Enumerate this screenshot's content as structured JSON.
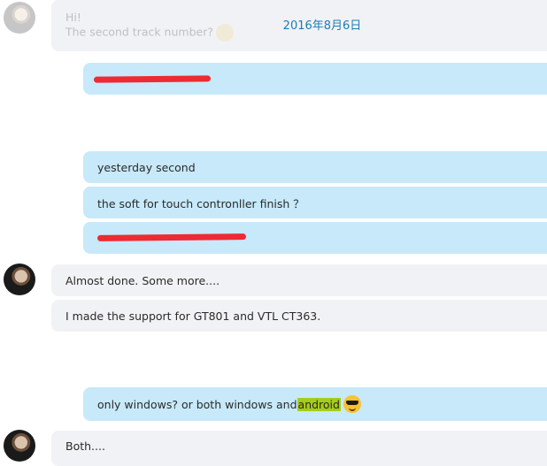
{
  "date_header": "2016年8月6日",
  "messages": {
    "m1": {
      "line1": "Hi!",
      "line2": "The second track number?"
    },
    "m2": {
      "text": ""
    },
    "m3": {
      "text": "yesterday second"
    },
    "m4": {
      "text": "the soft for touch contronller  finish ？"
    },
    "m5": {
      "text": ""
    },
    "m6": {
      "text": "Almost done. Some more...."
    },
    "m7": {
      "text": "I made the support for GT801 and VTL CT363."
    },
    "m8": {
      "prefix": "only windows? or  both windows and ",
      "highlight": "android"
    },
    "m9": {
      "text": "Both...."
    }
  },
  "colors": {
    "incoming_bg": "#f1f2f5",
    "outgoing_bg": "#c7e9f9",
    "date": "#1a7fb6",
    "highlight": "#a6cc1a",
    "redaction": "#ee2a32"
  },
  "icons": [
    "contact-avatar",
    "smile-emoji",
    "sunglasses-emoji"
  ]
}
